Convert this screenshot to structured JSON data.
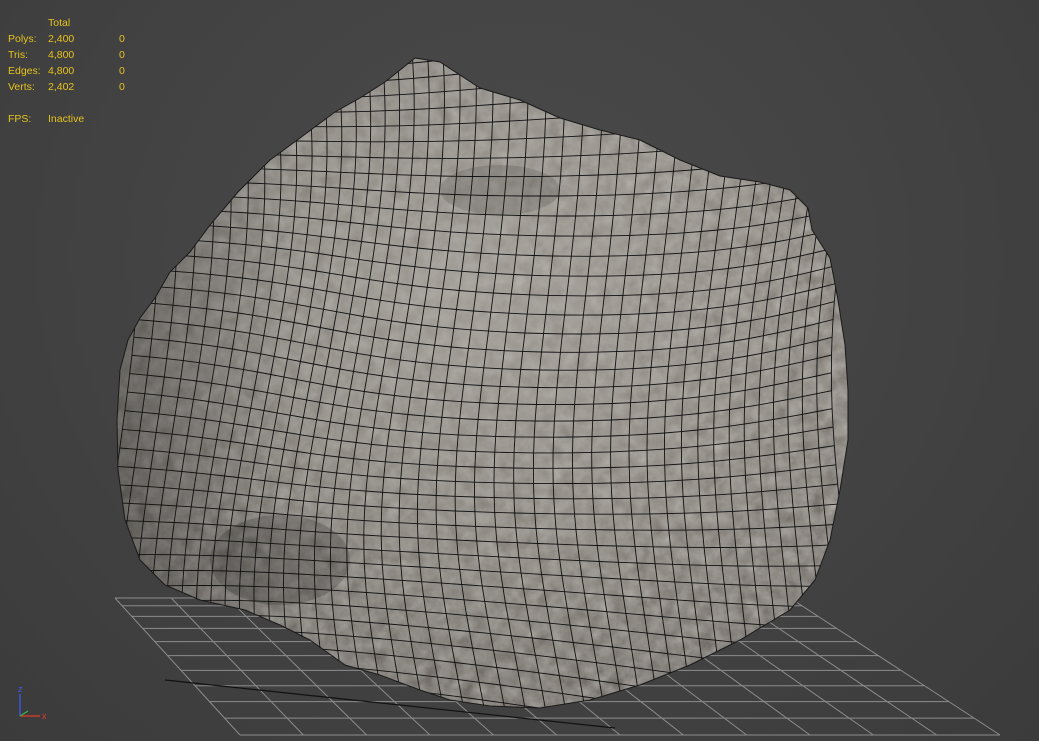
{
  "stats": {
    "column_header": "Total",
    "rows": [
      {
        "label": "Polys:",
        "total": "2,400",
        "selected": "0"
      },
      {
        "label": "Tris:",
        "total": "4,800",
        "selected": "0"
      },
      {
        "label": "Edges:",
        "total": "4,800",
        "selected": "0"
      },
      {
        "label": "Verts:",
        "total": "2,402",
        "selected": "0"
      }
    ],
    "fps_label": "FPS:",
    "fps_value": "Inactive"
  },
  "axis": {
    "z_label": "z",
    "x_label": "x",
    "z_color": "#3a5cf0",
    "x_color": "#e03b2a",
    "y_color": "#39b54a"
  },
  "colors": {
    "overlay_text": "#e6c21c",
    "viewport_bg": "#444444",
    "grid": "#8c8c8c",
    "wire": "#111111",
    "rock": "#8e8a84"
  },
  "scene": {
    "object": "rock-mesh",
    "shading": "textured-with-wireframe"
  }
}
